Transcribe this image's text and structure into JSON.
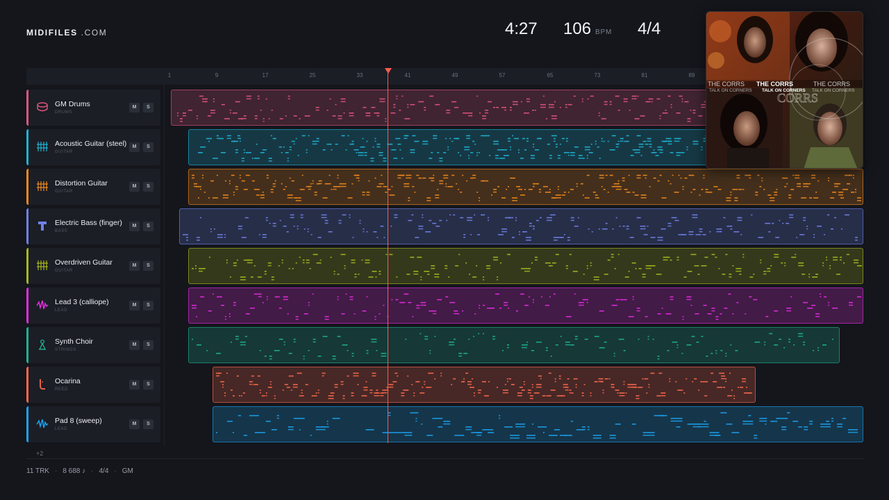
{
  "brand": {
    "name": "MIDIFILES",
    "suffix": " .COM"
  },
  "header": {
    "duration": "4:27",
    "tempo": "106",
    "tempo_unit": "BPM",
    "time_signature": "4/4"
  },
  "ruler": {
    "ticks": [
      "1",
      "9",
      "17",
      "25",
      "33",
      "41",
      "49",
      "57",
      "65",
      "73",
      "81",
      "89"
    ]
  },
  "buttons": {
    "mute": "M",
    "solo": "S"
  },
  "tracks": [
    {
      "name": "GM Drums",
      "category": "DRUMS",
      "color": "#e0557f",
      "icon": "drum-icon"
    },
    {
      "name": "Acoustic Guitar (steel)",
      "category": "GUITAR",
      "color": "#1fb3d4",
      "icon": "guitar-icon"
    },
    {
      "name": "Distortion Guitar",
      "category": "GUITAR",
      "color": "#f08a1e",
      "icon": "guitar-icon"
    },
    {
      "name": "Electric Bass (finger)",
      "category": "BASS",
      "color": "#6f82e8",
      "icon": "bass-icon"
    },
    {
      "name": "Overdriven Guitar",
      "category": "GUITAR",
      "color": "#a8b81e",
      "icon": "guitar-icon"
    },
    {
      "name": "Lead 3 (calliope)",
      "category": "LEAD",
      "color": "#e62ce2",
      "icon": "wave-icon"
    },
    {
      "name": "Synth Choir",
      "category": "STRINGS",
      "color": "#1fb294",
      "icon": "choir-icon"
    },
    {
      "name": "Ocarina",
      "category": "REED",
      "color": "#ff6a4d",
      "icon": "ocarina-icon"
    },
    {
      "name": "Pad 8 (sweep)",
      "category": "LEAD",
      "color": "#1aa3f0",
      "icon": "wave-icon"
    }
  ],
  "more_tracks": "+2",
  "footer": {
    "tracks": "11 TRK",
    "notes": "8 688 ♪",
    "time_signature": "4/4",
    "standard": "GM"
  },
  "album": {
    "band_text": "THE CORRS",
    "album_text": "TALK ON CORNERS",
    "logo_text": "CORRS"
  }
}
